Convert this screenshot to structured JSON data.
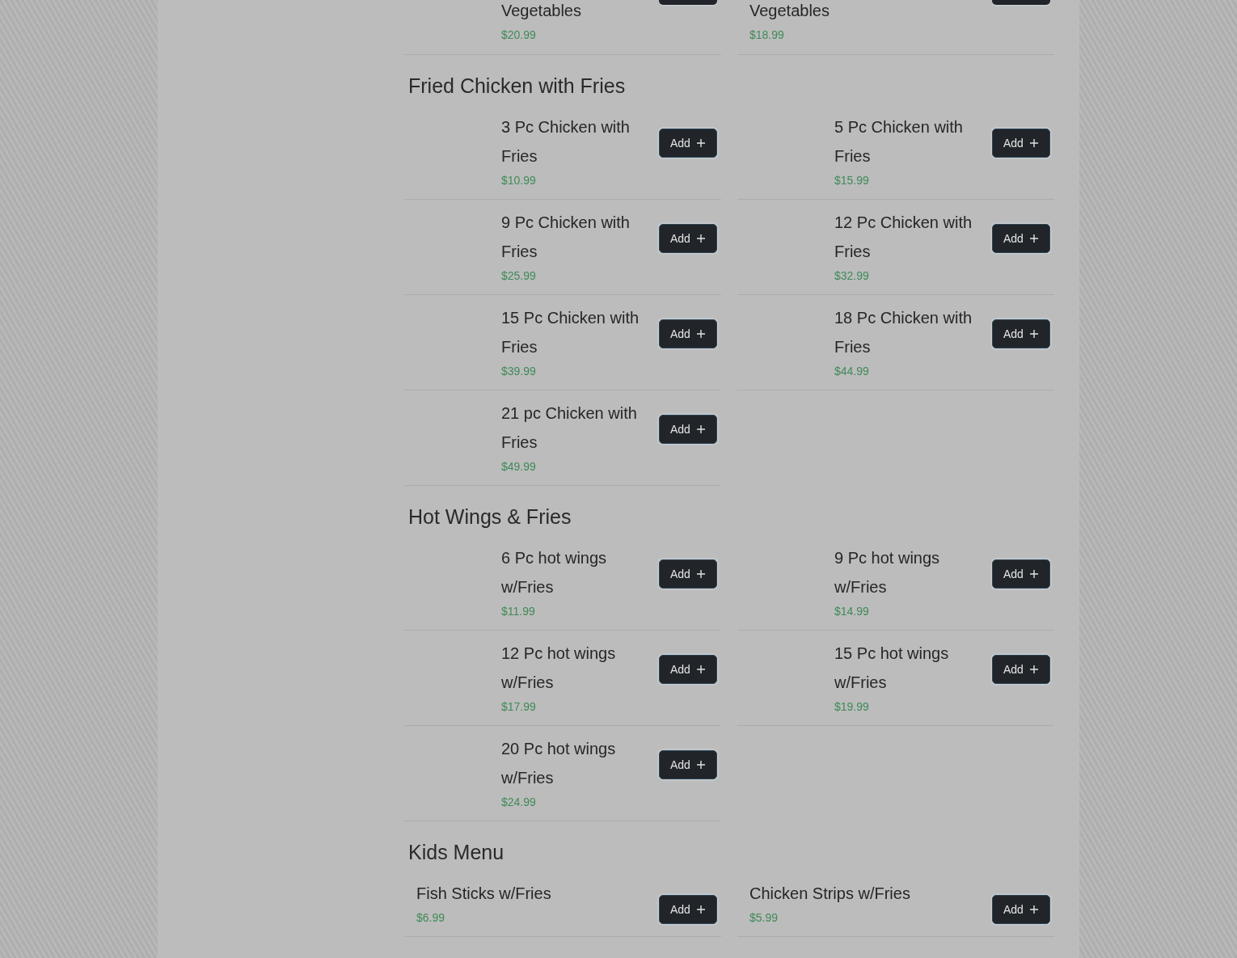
{
  "top_partial_items": [
    {
      "name": "Vegetables",
      "price": "$20.99",
      "kind": "indented"
    },
    {
      "name": "Vegetables",
      "price": "$18.99",
      "kind": "plain"
    }
  ],
  "sections": [
    {
      "title": "Fried Chicken with Fries",
      "items": [
        {
          "name": "3 Pc Chicken with Fries",
          "price": "$10.99",
          "kind": "indented",
          "button": "Add"
        },
        {
          "name": "5 Pc Chicken with Fries",
          "price": "$15.99",
          "kind": "indented",
          "button": "Add"
        },
        {
          "name": "9 Pc Chicken with Fries",
          "price": "$25.99",
          "kind": "indented",
          "button": "Add"
        },
        {
          "name": "12 Pc Chicken with Fries",
          "price": "$32.99",
          "kind": "indented",
          "button": "Add"
        },
        {
          "name": "15 Pc Chicken with Fries",
          "price": "$39.99",
          "kind": "indented",
          "button": "Add"
        },
        {
          "name": "18 Pc Chicken with Fries",
          "price": "$44.99",
          "kind": "indented",
          "button": "Add"
        },
        {
          "name": "21 pc Chicken with Fries",
          "price": "$49.99",
          "kind": "indented",
          "button": "Add"
        }
      ]
    },
    {
      "title": "Hot Wings & Fries",
      "items": [
        {
          "name": "6 Pc hot wings w/Fries",
          "price": "$11.99",
          "kind": "indented",
          "button": "Add"
        },
        {
          "name": "9 Pc hot wings w/Fries",
          "price": "$14.99",
          "kind": "indented",
          "button": "Add"
        },
        {
          "name": "12 Pc hot wings w/Fries",
          "price": "$17.99",
          "kind": "indented",
          "button": "Add"
        },
        {
          "name": "15 Pc hot wings w/Fries",
          "price": "$19.99",
          "kind": "indented",
          "button": "Add"
        },
        {
          "name": "20 Pc hot wings w/Fries",
          "price": "$24.99",
          "kind": "indented",
          "button": "Add"
        }
      ]
    },
    {
      "title": "Kids Menu",
      "items": [
        {
          "name": "Fish Sticks w/Fries",
          "price": "$6.99",
          "kind": "plain",
          "button": "Add"
        },
        {
          "name": "Chicken Strips w/Fries",
          "price": "$5.99",
          "kind": "plain",
          "button": "Add"
        }
      ]
    }
  ]
}
